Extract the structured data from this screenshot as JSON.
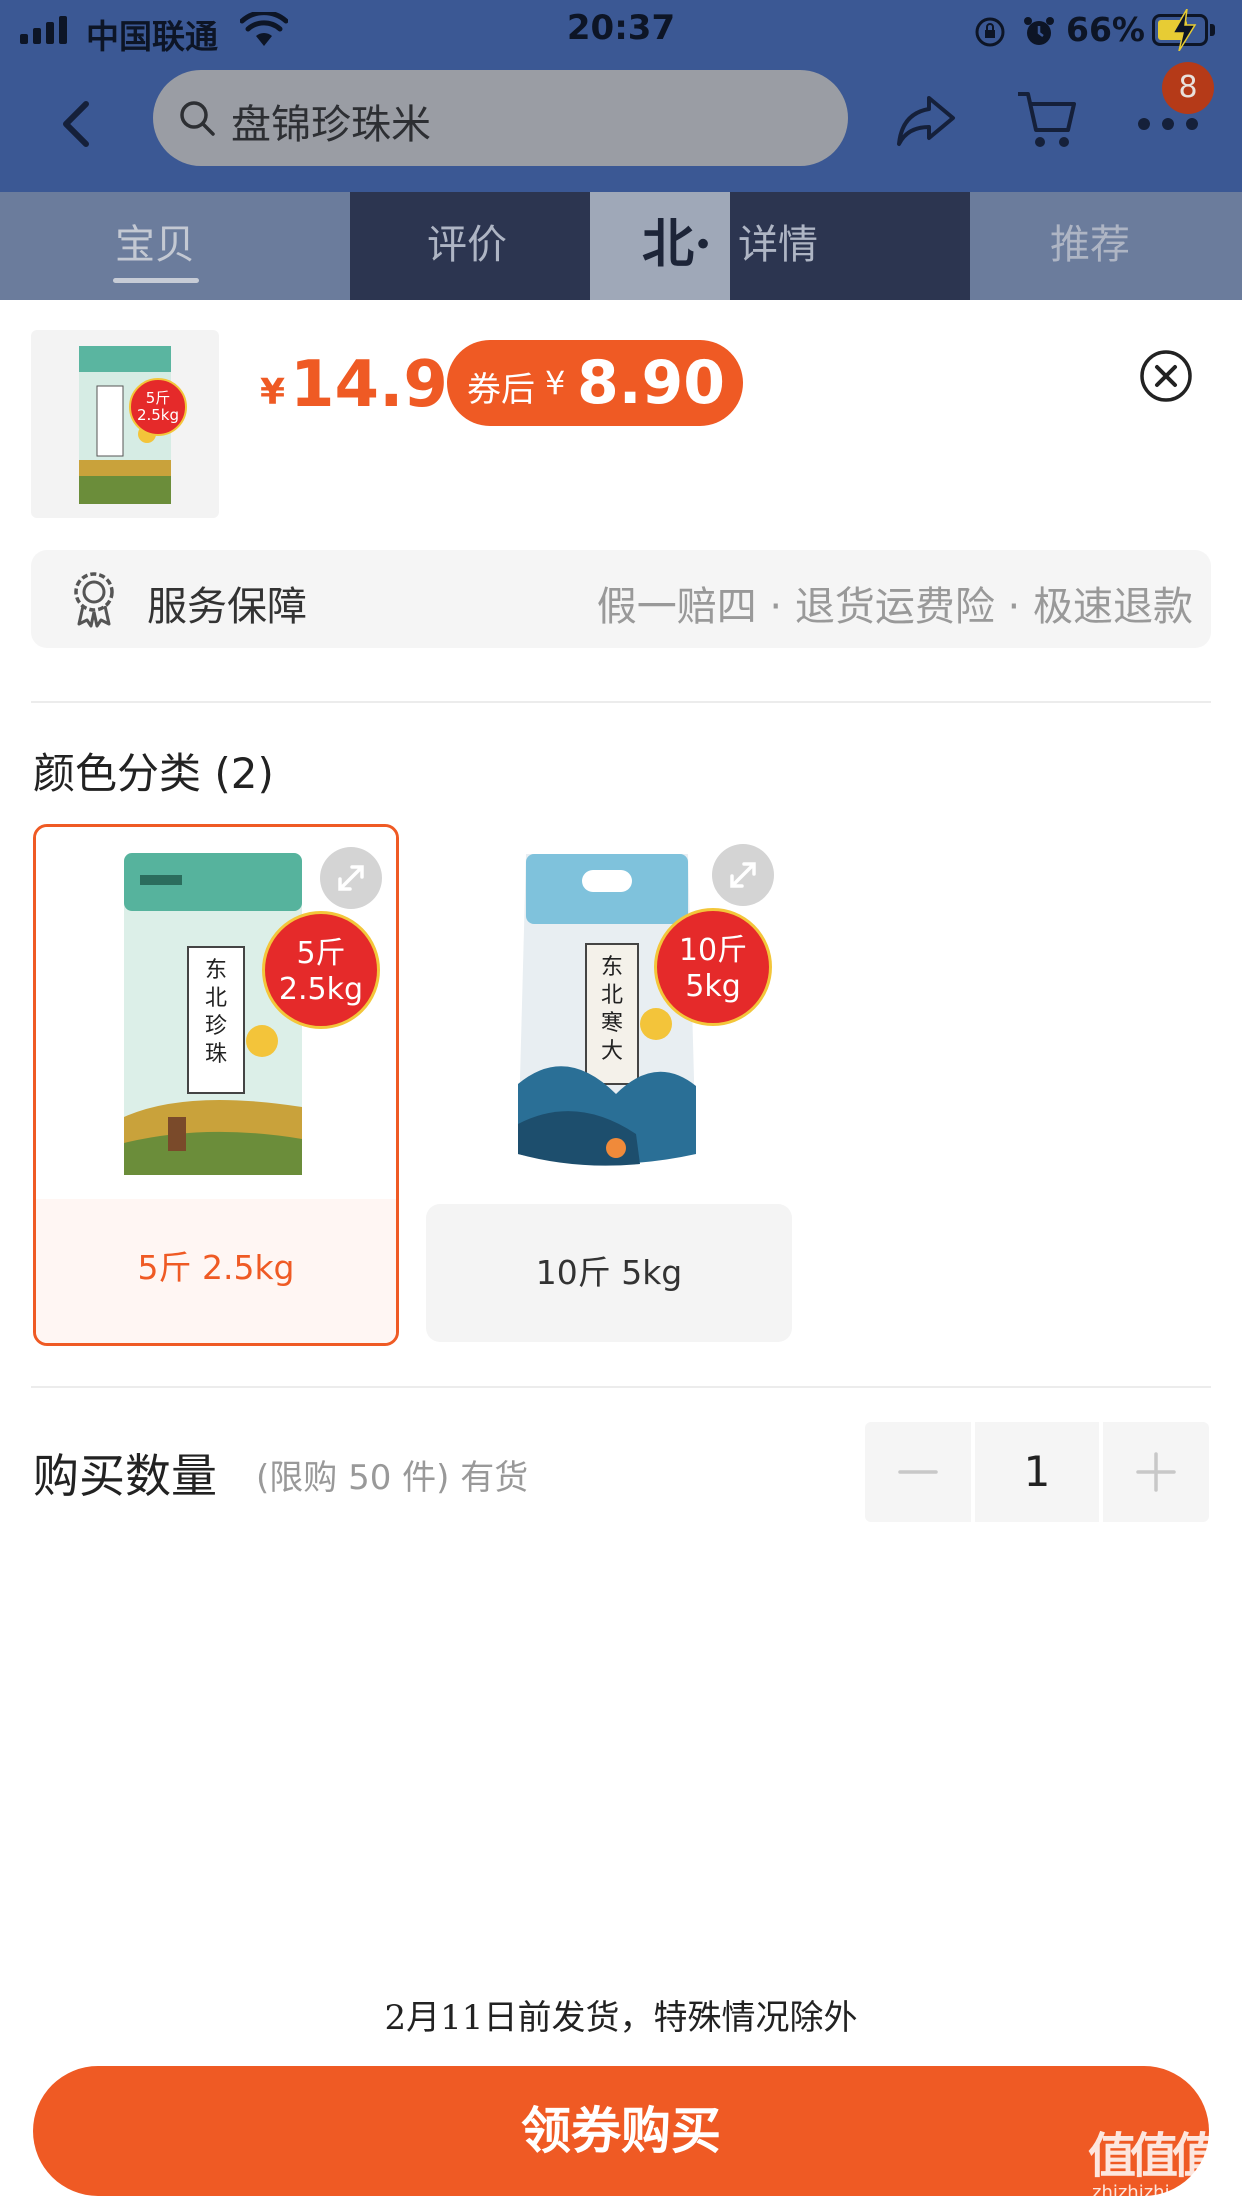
{
  "status_bar": {
    "carrier": "中国联通",
    "time": "20:37",
    "battery_percent": "66%",
    "battery_level": 0.66
  },
  "nav": {
    "search_query": "盘锦珍珠米",
    "cart_badge": "8"
  },
  "tabs": [
    {
      "label": "宝贝",
      "active": true
    },
    {
      "label": "评价",
      "active": false
    },
    {
      "label": "详情",
      "active": false
    },
    {
      "label": "推荐",
      "active": false
    }
  ],
  "product_strip_text": "北·",
  "price": {
    "currency": "¥",
    "current": "14.9",
    "coupon_label": "券后",
    "coupon_currency": "¥",
    "coupon_price": "8.90"
  },
  "thumbnail": {
    "badge_line1": "5斤",
    "badge_line2": "2.5kg"
  },
  "service": {
    "title": "服务保障",
    "items": "假一赔四 · 退货运费险 · 极速退款"
  },
  "variants": {
    "title": "颜色分类 (2)",
    "options": [
      {
        "label": "5斤 2.5kg",
        "badge_line1": "5斤",
        "badge_line2": "2.5kg",
        "selected": true
      },
      {
        "label": "10斤 5kg",
        "badge_line1": "10斤",
        "badge_line2": "5kg",
        "selected": false
      }
    ]
  },
  "quantity": {
    "label": "购买数量",
    "note": "(限购 50 件) 有货",
    "value": "1"
  },
  "shipping_note": "2月11日前发货，特殊情况除外",
  "buy_button": "领券购买",
  "watermark": {
    "main": "值值值",
    "sub": "zhizhizhi.com"
  },
  "colors": {
    "accent": "#ef5a24",
    "header_dim": "#3b5894",
    "badge_red": "#e52a2a"
  }
}
